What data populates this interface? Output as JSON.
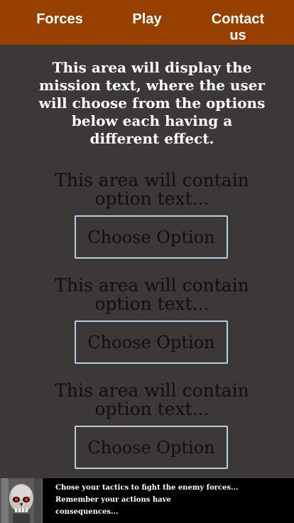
{
  "nav": {
    "forces": "Forces",
    "play": "Play",
    "contact_line1": "Contact",
    "contact_line2": "us"
  },
  "mission": {
    "text": "This area will display the mission text, where the user will choose from the options below each having a different effect."
  },
  "options": [
    {
      "text_line1": "This area will contain",
      "text_line2": "option text...",
      "button": "Choose Option"
    },
    {
      "text_line1": "This area will contain",
      "text_line2": "option text...",
      "button": "Choose Option"
    },
    {
      "text_line1": "This area will contain",
      "text_line2": "option text...",
      "button": "Choose Option"
    }
  ],
  "footer": {
    "avatar_icon": "skull-robot-icon",
    "line1": "Chose your tactics to fight the enemy forces...",
    "line2": "Remember your actions have",
    "line3": "consequences..."
  },
  "colors": {
    "nav_bg": "#974000",
    "page_bg": "#3b3837",
    "button_border": "#b9cde0",
    "footer_bg": "#000000"
  }
}
